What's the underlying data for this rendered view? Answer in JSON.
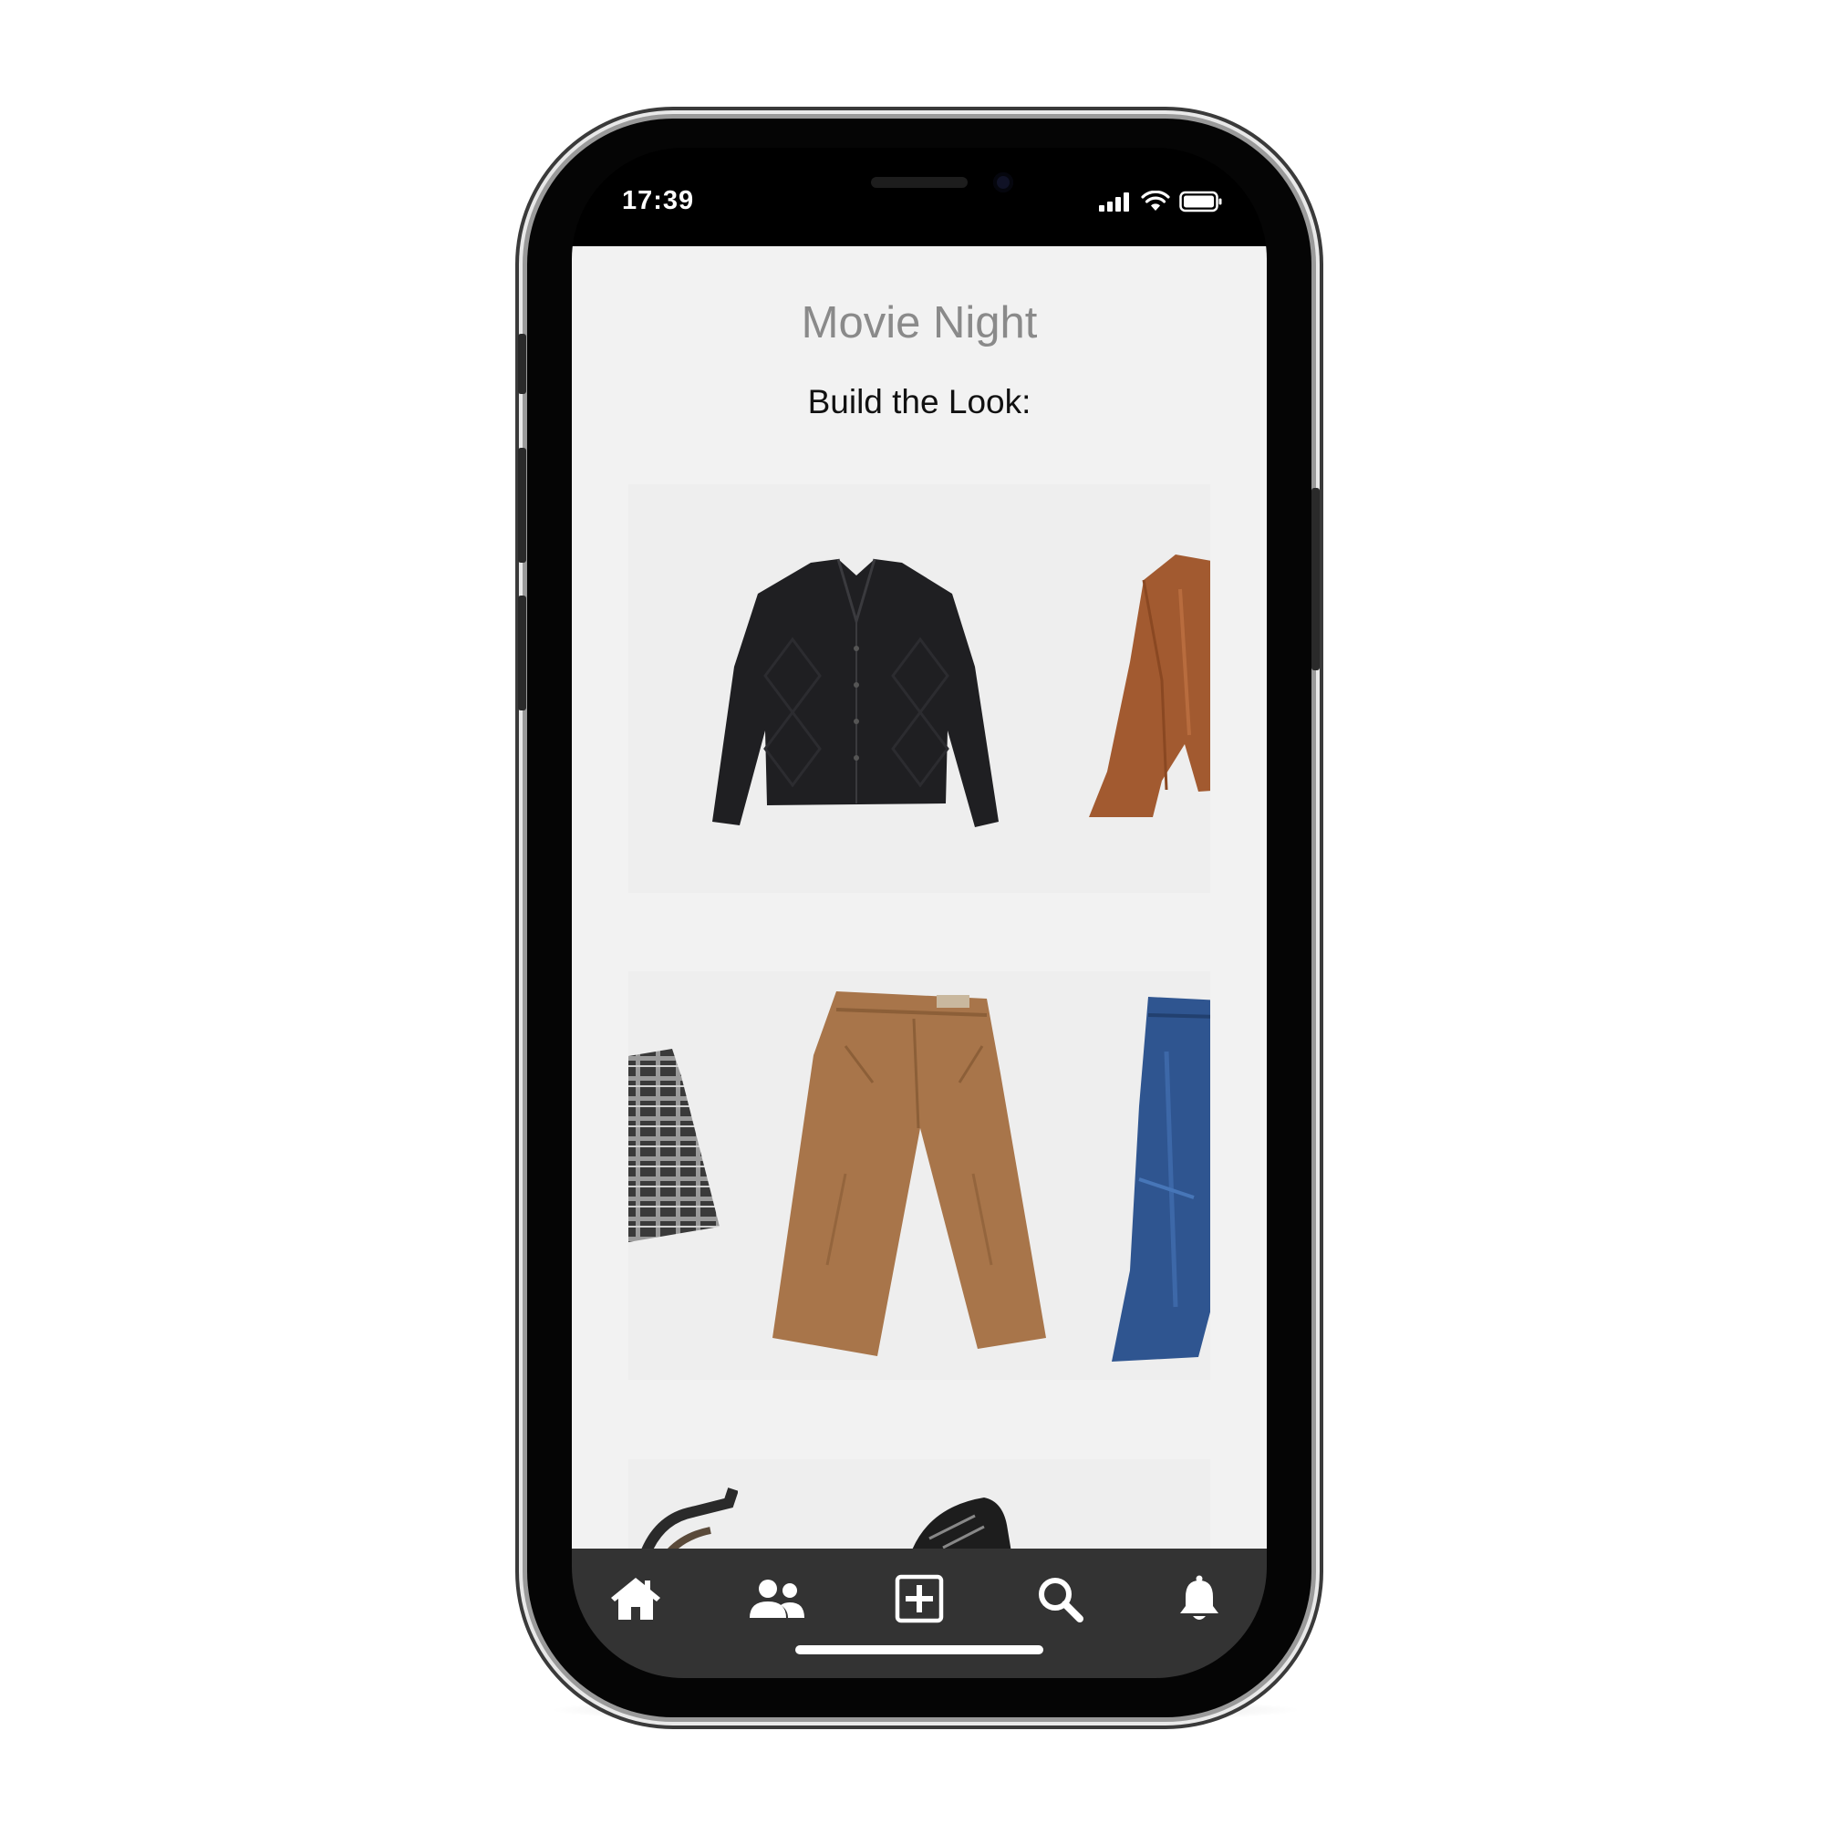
{
  "status_bar": {
    "time": "17:39",
    "icons": [
      "signal-icon",
      "wifi-icon",
      "battery-icon"
    ]
  },
  "page": {
    "title": "Movie Night",
    "subtitle": "Build the Look:"
  },
  "carousels": [
    {
      "name": "tops",
      "items": [
        "black-cardigan",
        "rust-blouse"
      ]
    },
    {
      "name": "bottoms",
      "items": [
        "plaid-skirt",
        "tan-wide-leg-pants",
        "blue-jeans"
      ]
    },
    {
      "name": "shoes",
      "items": [
        "sandal",
        "black-sneakers"
      ]
    }
  ],
  "nav": {
    "items": [
      "home-icon",
      "users-icon",
      "plus-square-icon",
      "search-icon",
      "bell-icon"
    ]
  },
  "colors": {
    "screen_bg": "#f2f2f2",
    "nav_bg": "#333333",
    "title": "#8a8a8a",
    "subtitle": "#111111"
  }
}
